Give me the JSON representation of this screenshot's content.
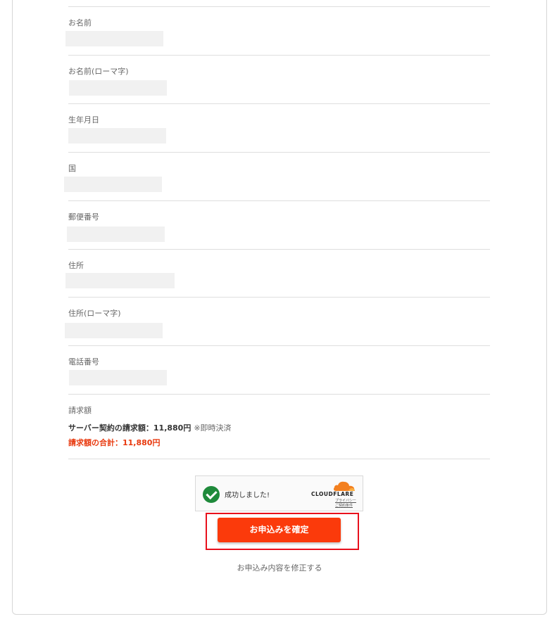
{
  "form": {
    "fields": [
      {
        "label": "お名前"
      },
      {
        "label": "お名前(ローマ字)"
      },
      {
        "label": "生年月日"
      },
      {
        "label": "国"
      },
      {
        "label": "郵便番号"
      },
      {
        "label": "住所"
      },
      {
        "label": "住所(ローマ字)"
      },
      {
        "label": "電話番号"
      }
    ]
  },
  "billing": {
    "label": "請求額",
    "server_line": "サーバー契約の請求額：11,880円",
    "server_note": "※即時決済",
    "total_line": "請求額の合計：11,880円",
    "total_color": "#e8380d"
  },
  "turnstile": {
    "status_text": "成功しました!",
    "brand": "CLOUDFLARE",
    "privacy_link": "プライバシー",
    "terms_link": "ご契約条件",
    "check_icon": "check-circle-icon",
    "check_color": "#1f8a3b",
    "brand_color": "#f38020"
  },
  "actions": {
    "confirm_label": "お申込みを確定",
    "confirm_color": "#fb3a0b",
    "modify_label": "お申込み内容を修正する"
  },
  "highlight_color": "#e8101c"
}
